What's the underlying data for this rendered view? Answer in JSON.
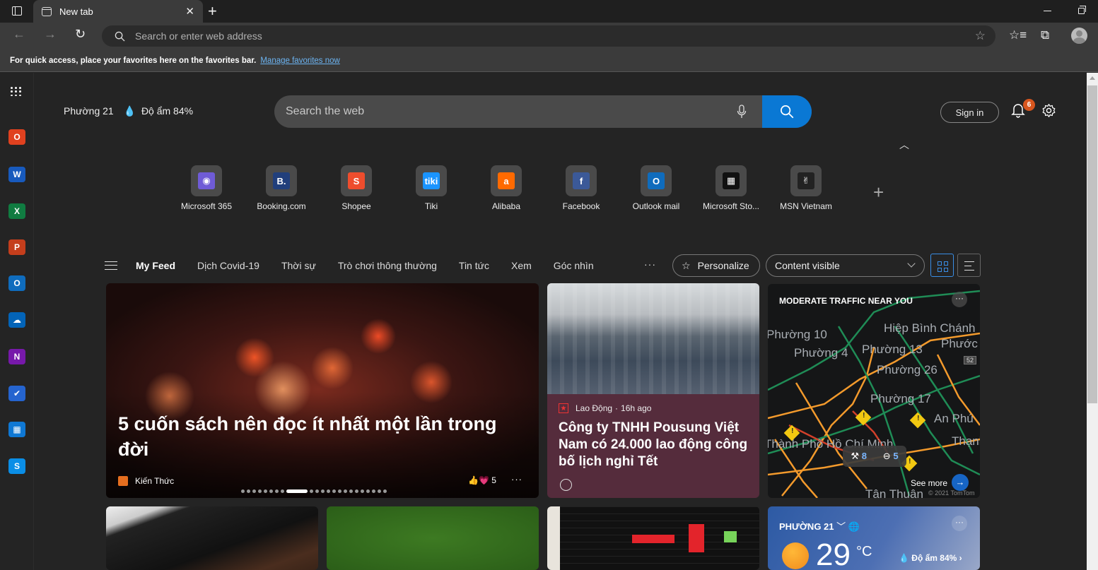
{
  "browser": {
    "tab_title": "New tab",
    "address_placeholder": "Search or enter web address",
    "favorites_bar_text": "For quick access, place your favorites here on the favorites bar.",
    "favorites_bar_link": "Manage favorites now"
  },
  "app_rail": {
    "items": [
      {
        "name": "office",
        "glyph": "O",
        "color": "#e0411f"
      },
      {
        "name": "word",
        "glyph": "W",
        "color": "#185abd"
      },
      {
        "name": "excel",
        "glyph": "X",
        "color": "#107c41"
      },
      {
        "name": "powerpoint",
        "glyph": "P",
        "color": "#c43e1c"
      },
      {
        "name": "outlook",
        "glyph": "O",
        "color": "#0f6cbd"
      },
      {
        "name": "onedrive",
        "glyph": "☁",
        "color": "#0364b8"
      },
      {
        "name": "onenote",
        "glyph": "N",
        "color": "#7719aa"
      },
      {
        "name": "todo",
        "glyph": "✔",
        "color": "#2564cf"
      },
      {
        "name": "calendar",
        "glyph": "▦",
        "color": "#0f78d4"
      },
      {
        "name": "skype",
        "glyph": "S",
        "color": "#0a8ee6"
      }
    ]
  },
  "header": {
    "location": "Phường 21",
    "humidity": "Độ ẩm 84%",
    "search_placeholder": "Search the web",
    "sign_in": "Sign in",
    "notification_count": "6"
  },
  "top_sites": [
    {
      "label": "Microsoft 365",
      "glyph": "◉",
      "color": "#6f5bd6"
    },
    {
      "label": "Booking.com",
      "glyph": "B.",
      "color": "#213f7c"
    },
    {
      "label": "Shopee",
      "glyph": "S",
      "color": "#ee4d2d"
    },
    {
      "label": "Tiki",
      "glyph": "tiki",
      "color": "#1a94ff"
    },
    {
      "label": "Alibaba",
      "glyph": "a",
      "color": "#ff6a00"
    },
    {
      "label": "Facebook",
      "glyph": "f",
      "color": "#3b5998"
    },
    {
      "label": "Outlook mail",
      "glyph": "O",
      "color": "#0f6cbd"
    },
    {
      "label": "Microsoft Sto...",
      "glyph": "▦",
      "color": "#111111"
    },
    {
      "label": "MSN Vietnam",
      "glyph": "✌",
      "color": "#222222"
    }
  ],
  "feed": {
    "tabs": [
      "My Feed",
      "Dịch Covid-19",
      "Thời sự",
      "Trò chơi thông thường",
      "Tin tức",
      "Xem",
      "Góc nhìn"
    ],
    "active_tab": "My Feed",
    "more": "···",
    "personalize": "Personalize",
    "content_visibility": "Content visible"
  },
  "cards": {
    "hero": {
      "title": "5 cuốn sách nên đọc ít nhất một lần trong đời",
      "source": "Kiến Thức",
      "reactions": "5",
      "carousel_total": 23,
      "carousel_active": 8
    },
    "news": {
      "source": "Lao Động",
      "age": "16h ago",
      "title": "Công ty TNHH Pousung Việt Nam có 24.000 lao động công bố lịch nghỉ Tết"
    },
    "traffic": {
      "title": "MODERATE TRAFFIC NEAR YOU",
      "places": [
        "Hiệp Bình Chánh",
        "Phường 10",
        "Phường 4",
        "Phường 13",
        "Phước",
        "Phường 26",
        "Phường 17",
        "An Phú",
        "Thành Phố Hồ Chí Minh",
        "Thạnh",
        "Tân Thuận"
      ],
      "road_badge": "52",
      "construction_count": "8",
      "closure_count": "5",
      "see_more": "See more",
      "copyright": "© 2021 TomTom"
    },
    "weather": {
      "location": "PHƯỜNG 21",
      "temperature": "29",
      "unit": "°C",
      "humidity": "Độ ẩm 84%"
    }
  }
}
